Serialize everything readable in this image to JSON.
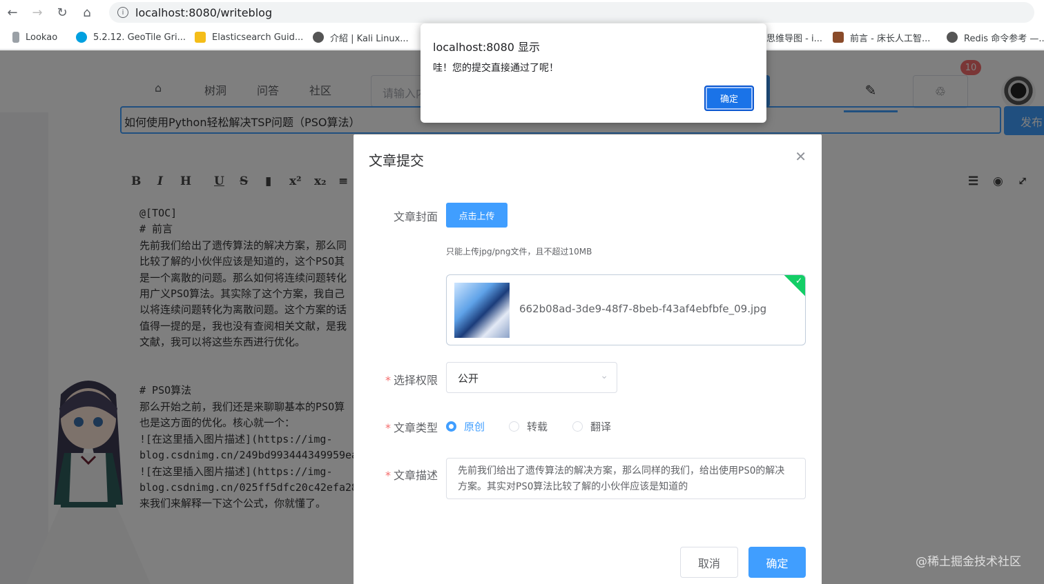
{
  "browser": {
    "url": "localhost:8080/writeblog",
    "bookmarks": [
      {
        "label": "Lookao",
        "color": "#9aa0a6"
      },
      {
        "label": "5.2.12. GeoTile Gri...",
        "color": "#00a0e0"
      },
      {
        "label": "Elasticsearch Guid...",
        "color": "#f4bd19"
      },
      {
        "label": "介紹 | Kali Linux...",
        "color": "#555555"
      },
      {
        "label": "思维导图 - i...",
        "color": "#777777"
      },
      {
        "label": "前言 - 床长人工智...",
        "color": "#8a4b2a"
      },
      {
        "label": "Redis 命令参考 —...",
        "color": "#555555"
      }
    ]
  },
  "site": {
    "nav": [
      "树洞",
      "问答",
      "社区"
    ],
    "search_placeholder": "请输入内",
    "badge": "10",
    "title_value": "如何使用Python轻松解决TSP问题（PSO算法）",
    "publish_label": "发布",
    "toolbar": [
      "B",
      "I",
      "H",
      "U",
      "S",
      "▮",
      "x²",
      "x₂",
      "≡"
    ],
    "markdown": "@[TOC]\n# 前言\n先前我们给出了遗传算法的解决方案，那么同\n比较了解的小伙伴应该是知道的，这个PSO其\n是一个离散的问题。那么如何将连续问题转化\n用广义PSO算法。其实除了这个方案，我自己\n以将连续问题转化为离散问题。这个方案的话\n值得一提的是，我也没有查阅相关文献，是我\n文献，我可以将这些东西进行优化。\n\n\n# PSO算法\n那么开始之前，我们还是来聊聊基本的PSO算\n也是这方面的优化。核心就一个：\n![在这里插入图片描述](https://img-\nblog.csdnimg.cn/249bd993444349959ea2\n![在这里插入图片描述](https://img-\nblog.csdnimg.cn/025ff5dfc20c42efa282\n来我们来解释一下这个公式，你就懂了。"
  },
  "dialog": {
    "title": "文章提交",
    "cover_label": "文章封面",
    "upload_button": "点击上传",
    "upload_tip": "只能上传jpg/png文件，且不超过10MB",
    "file_name": "662b08ad-3de9-48f7-8beb-f43af4ebfbfe_09.jpg",
    "permission_label": "选择权限",
    "permission_value": "公开",
    "type_label": "文章类型",
    "types": [
      "原创",
      "转载",
      "翻译"
    ],
    "desc_label": "文章描述",
    "desc_value": "先前我们给出了遗传算法的解决方案，那么同样的我们，给出使用PSO的解决方案。其实对PSO算法比较了解的小伙伴应该是知道的",
    "cancel": "取消",
    "confirm": "确定"
  },
  "alert": {
    "title": "localhost:8080 显示",
    "message": "哇！您的提交直接通过了呢！",
    "ok": "确定"
  },
  "watermark": "@稀土掘金技术社区",
  "colors": {
    "primary": "#409eff",
    "danger": "#f56c6c",
    "success": "#13ce66"
  }
}
